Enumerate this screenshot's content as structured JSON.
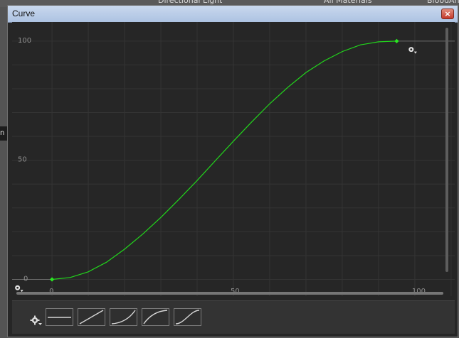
{
  "background": {
    "tab_directional": "Directional Light",
    "tab_all_materials": "All Materials",
    "tab_blood": "BloodAn",
    "left_label": "n l"
  },
  "window": {
    "title": "Curve",
    "close_label": "×"
  },
  "chart_data": {
    "type": "line",
    "title": "",
    "xlabel": "",
    "ylabel": "",
    "x_ticks": [
      "0",
      "50",
      "100"
    ],
    "y_ticks": [
      "0",
      "50",
      "100"
    ],
    "xlim": [
      -11,
      111
    ],
    "ylim": [
      -7,
      108
    ],
    "grid": true,
    "series": [
      {
        "x": [
          0,
          5,
          10,
          15,
          20,
          25,
          30,
          35,
          40,
          45,
          50,
          55,
          60,
          65,
          70,
          75,
          80,
          85,
          90,
          95
        ],
        "y": [
          0,
          0.8,
          3.2,
          7.2,
          12.7,
          19.0,
          26.0,
          33.6,
          41.5,
          49.8,
          58.0,
          66.0,
          73.7,
          80.6,
          86.8,
          91.7,
          95.6,
          98.4,
          99.7,
          100
        ]
      }
    ],
    "keys": [
      {
        "x": 0,
        "y": 0
      },
      {
        "x": 95,
        "y": 100
      }
    ],
    "line_color": "#22d61c",
    "key_color": "#2ae622",
    "grid_color": "#343434",
    "baseline_color": "#6a6a6a"
  },
  "presets": [
    {
      "name": "constant"
    },
    {
      "name": "linear"
    },
    {
      "name": "ease-in"
    },
    {
      "name": "ease-out"
    },
    {
      "name": "ease-in-out"
    }
  ],
  "icons": {
    "settings": "gear-icon",
    "close": "close-icon"
  },
  "colors": {
    "window_bg": "#262626",
    "title_bg": "#bfd0ea",
    "curve": "#22d61c"
  }
}
